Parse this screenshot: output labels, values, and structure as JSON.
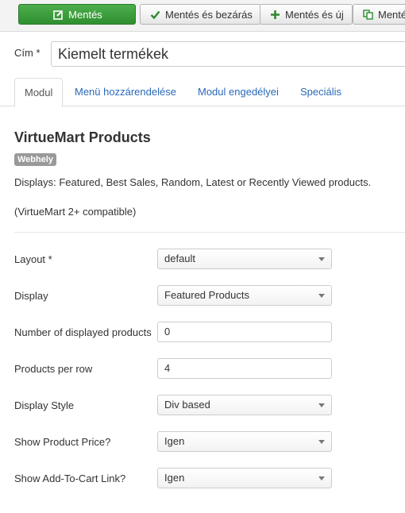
{
  "toolbar": {
    "save": "Mentés",
    "save_close": "Mentés és bezárás",
    "save_new": "Mentés és új",
    "save_copy": "Mentés"
  },
  "title_field": {
    "label": "Cím *",
    "value": "Kiemelt termékek"
  },
  "tabs": [
    "Modul",
    "Menü hozzárendelése",
    "Modul engedélyei",
    "Speciális"
  ],
  "module": {
    "title": "VirtueMart Products",
    "badge": "Webhely",
    "description": "Displays: Featured, Best Sales, Random, Latest or Recently Viewed products.",
    "compat": "(VirtueMart 2+ compatible)"
  },
  "fields": [
    {
      "label": "Layout *",
      "value": "default",
      "type": "select"
    },
    {
      "label": "Display",
      "value": "Featured Products",
      "type": "select"
    },
    {
      "label": "Number of displayed products",
      "value": "0",
      "type": "text"
    },
    {
      "label": "Products per row",
      "value": "4",
      "type": "text"
    },
    {
      "label": "Display Style",
      "value": "Div based",
      "type": "select"
    },
    {
      "label": "Show Product Price?",
      "value": "Igen",
      "type": "select"
    },
    {
      "label": "Show Add-To-Cart Link?",
      "value": "Igen",
      "type": "select"
    }
  ],
  "icons": {
    "save": "edit-icon",
    "save_close": "check-icon",
    "save_new": "plus-icon",
    "save_copy": "copy-icon"
  },
  "colors": {
    "primary": "#3a9d3a",
    "link": "#2a69b8",
    "badge": "#999999"
  }
}
